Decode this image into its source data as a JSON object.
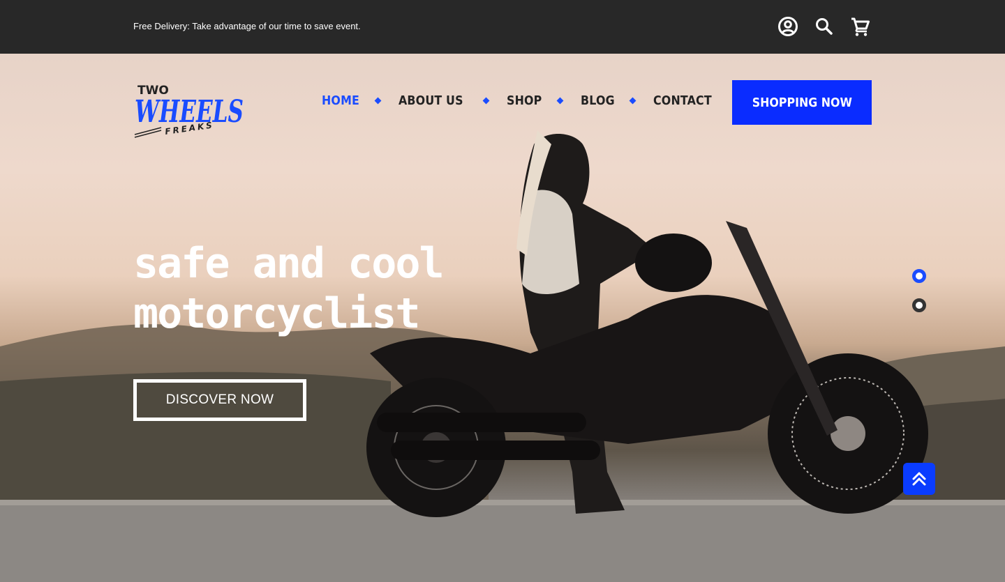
{
  "topbar": {
    "promo_text": "Free Delivery: Take advantage of our time to save event.",
    "icons": [
      "account-icon",
      "search-icon",
      "cart-icon"
    ]
  },
  "brand": {
    "logo_top": "TWO",
    "logo_main": "WHEELS",
    "logo_bottom": "FREAKS",
    "accent_color": "#1a4cff"
  },
  "nav": {
    "items": [
      {
        "label": "HOME",
        "active": true
      },
      {
        "label": "ABOUT US",
        "active": false
      },
      {
        "label": "SHOP",
        "active": false
      },
      {
        "label": "BLOG",
        "active": false
      },
      {
        "label": "CONTACT",
        "active": false
      }
    ]
  },
  "cta": {
    "shop_label": "SHOPPING NOW",
    "discover_label": "DISCOVER NOW"
  },
  "hero": {
    "headline_line1": "safe and cool",
    "headline_line2": "motorcyclist",
    "slides_total": 2,
    "active_slide": 1
  },
  "scroll_top_icon": "chevrons-up-icon"
}
